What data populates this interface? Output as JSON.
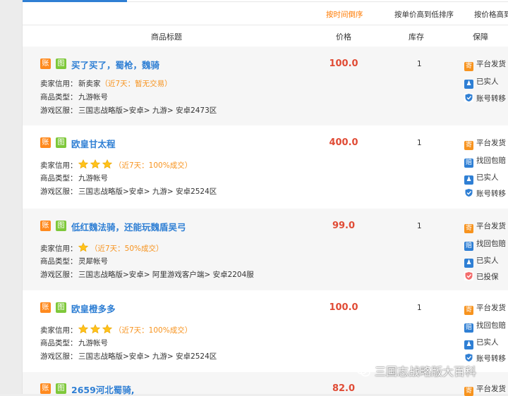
{
  "sort_options": [
    "按时间倒序",
    "按单价高到低排序",
    "按价格高到"
  ],
  "columns": {
    "title": "商品标题",
    "price": "价格",
    "stock": "库存",
    "guarantee": "保障"
  },
  "labels": {
    "seller_credit": "卖家信用：",
    "item_type": "商品类型：",
    "server": "游戏区服："
  },
  "badges": {
    "account": "账",
    "image": "图"
  },
  "guarantee_labels": {
    "ship": "平台发货",
    "refund": "找回包赔",
    "real": "已实实人",
    "transfer": "账号转移",
    "insured": "已投保"
  },
  "listings": [
    {
      "title": "买了买了，蜀枪，魏骑",
      "price": "100.0",
      "stock": "1",
      "stars": 0,
      "credit_prefix": "新卖家",
      "credit_note": "（近7天：暂无交易）",
      "type": "九游帐号",
      "server": "三国志战略版>安卓> 九游> 安卓2473区",
      "guarantees": [
        "平台发货",
        "已实人",
        "账号转移"
      ]
    },
    {
      "title": "欧皇甘太程",
      "price": "400.0",
      "stock": "1",
      "stars": 3,
      "credit_prefix": "",
      "credit_note": "（近7天：100%成交）",
      "type": "九游帐号",
      "server": "三国志战略版>安卓> 九游> 安卓2524区",
      "guarantees": [
        "平台发货",
        "找回包赔",
        "已实人",
        "账号转移"
      ]
    },
    {
      "title": "低红魏法骑，还能玩魏盾吴弓",
      "price": "99.0",
      "stock": "1",
      "stars": 1,
      "credit_prefix": "",
      "credit_note": "（近7天：50%成交）",
      "type": "灵犀帐号",
      "server": "三国志战略版>安卓> 阿里游戏客户端> 安卓2204服",
      "guarantees": [
        "平台发货",
        "找回包赔",
        "已实人",
        "已投保"
      ]
    },
    {
      "title": "欧皇橙多多",
      "price": "100.0",
      "stock": "1",
      "stars": 3,
      "credit_prefix": "",
      "credit_note": "（近7天：100%成交）",
      "type": "九游帐号",
      "server": "三国志战略版>安卓> 九游> 安卓2524区",
      "guarantees": [
        "平台发货",
        "找回包赔",
        "已实人",
        "账号转移"
      ]
    },
    {
      "title": "2659河北蜀骑,",
      "price": "82.0",
      "stock": "",
      "stars": 0,
      "credit_prefix": "",
      "credit_note": "",
      "type": "",
      "server": "",
      "guarantees": [
        "平台发货"
      ]
    }
  ],
  "watermark": "三国志战略版大百科",
  "colors": {
    "accent_blue": "#2f7fd4",
    "price_red": "#e04b35",
    "sort_orange": "#ff7a00",
    "star_yellow": "#ffc21a"
  }
}
